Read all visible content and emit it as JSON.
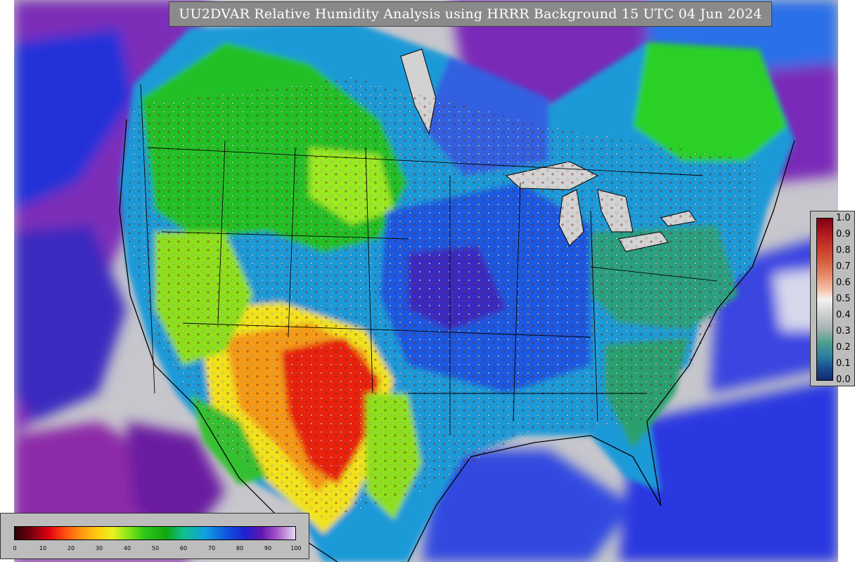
{
  "title": "UU2DVAR Relative Humidity Analysis using HRRR Background 15 UTC 04 Jun 2024",
  "map": {
    "colors": {
      "ocean_far": "#c8c8cc",
      "ocean_purple": "#7a2fb0",
      "ocean_blue": "#2430d8",
      "land_cyan": "#1aa6d8",
      "land_blue": "#1e5be0",
      "land_green": "#1fc020",
      "land_lime": "#8ee81a",
      "land_yellow": "#f6e01a",
      "land_orange": "#f59a10",
      "land_red": "#e81e10",
      "lake_gray": "#d4d4d4",
      "boundary": "#000000"
    }
  },
  "rh_legend": {
    "ticks": [
      "0",
      "10",
      "20",
      "30",
      "40",
      "50",
      "60",
      "70",
      "80",
      "90",
      "100"
    ]
  },
  "ratio_legend": {
    "ticks": [
      "1.0",
      "0.9",
      "0.8",
      "0.7",
      "0.6",
      "0.5",
      "0.4",
      "0.3",
      "0.2",
      "0.1",
      "0.0"
    ]
  }
}
